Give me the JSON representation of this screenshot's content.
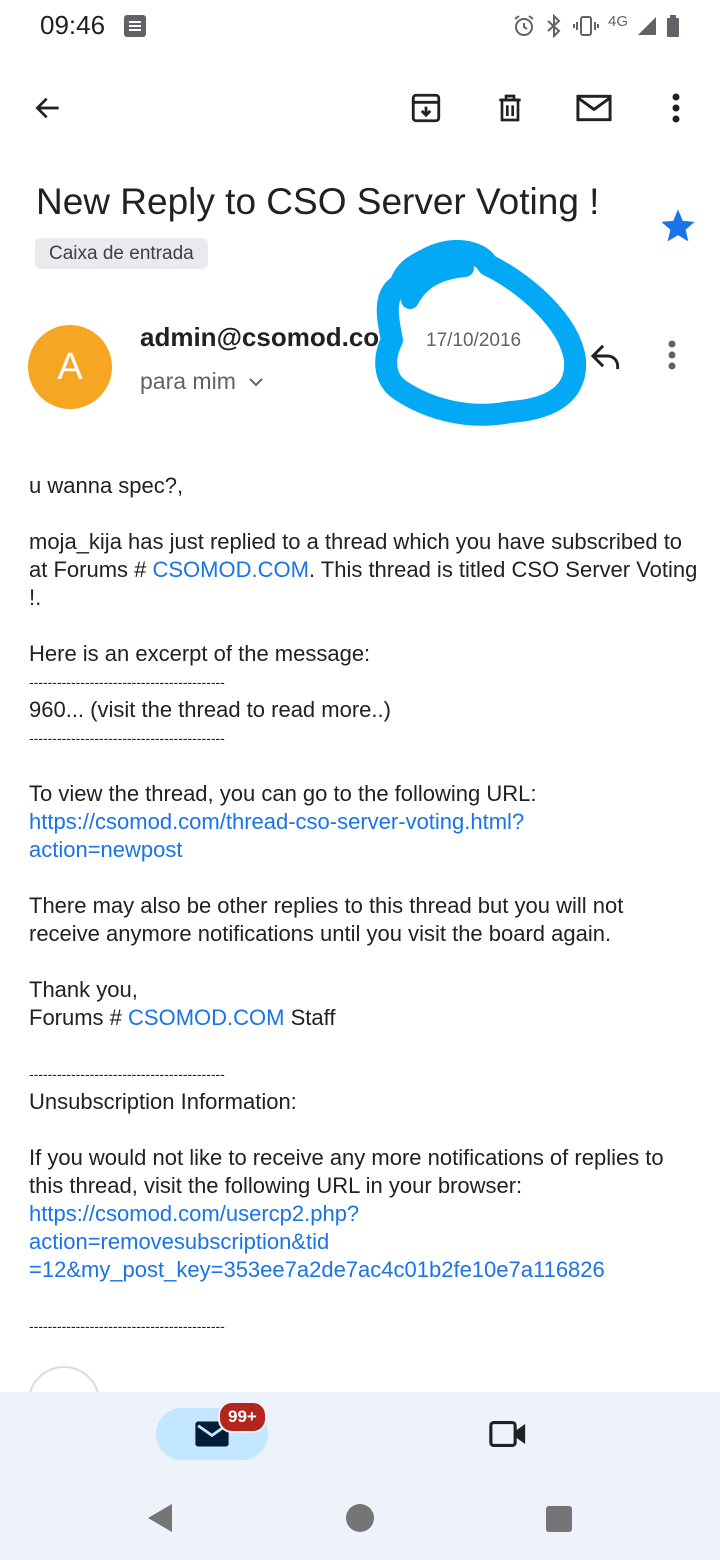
{
  "status_bar": {
    "time": "09:46",
    "network": "4G"
  },
  "toolbar": {
    "back_icon": "arrow-left-icon",
    "archive_icon": "archive-icon",
    "delete_icon": "trash-icon",
    "unread_icon": "mail-icon",
    "more_icon": "more-vert-icon"
  },
  "email": {
    "subject": "New Reply to CSO Server Voting !",
    "label": "Caixa de entrada",
    "starred": true,
    "sender_initial": "A",
    "sender": "admin@csomod.co",
    "recipient": "para mim",
    "date": "17/10/2016"
  },
  "body": {
    "greeting": "u wanna spec?,",
    "p1_start": "moja_kija has just replied to a thread which you have subscribed to at Forums # ",
    "p1_link": "CSOMOD.COM",
    "p1_end": ". This thread is titled CSO Server Voting !.",
    "excerpt_intro": "Here is an excerpt of the message:",
    "divider": "------------------------------------------",
    "excerpt": "960... (visit the thread to read more..)",
    "view_intro": "To view the thread, you can go to the following URL:",
    "view_url": "https://csomod.com/thread-cso-server-voting.html?action=newpost",
    "view_url_line1": "https://csomod.com/thread-cso-server-voting.html?",
    "view_url_line2": "action=newpost",
    "other_replies": "There may also be other replies to this thread but you will not receive anymore notifications until you visit the board again.",
    "thanks": "Thank you,",
    "sign_start": "Forums # ",
    "sign_link": "CSOMOD.COM",
    "sign_end": " Staff",
    "unsub_title": "Unsubscription Information:",
    "unsub_text": "If you would not like to receive any more notifications of replies to this thread, visit the following URL in your browser:",
    "unsub_url_line1": "https://csomod.com/usercp2.php?",
    "unsub_url_line2": "action=removesubscription&tid",
    "unsub_url_line3": "=12&my_post_key=353ee7a2de7ac4c01b2fe10e7a116826"
  },
  "bottom_nav": {
    "mail_badge": "99+",
    "mail_icon": "mail-icon",
    "meet_icon": "video-camera-icon"
  },
  "colors": {
    "link": "#1a73e8",
    "star": "#1a73e8",
    "avatar": "#f6a623",
    "scribble": "#03a9f4",
    "badge": "#b3261e"
  }
}
